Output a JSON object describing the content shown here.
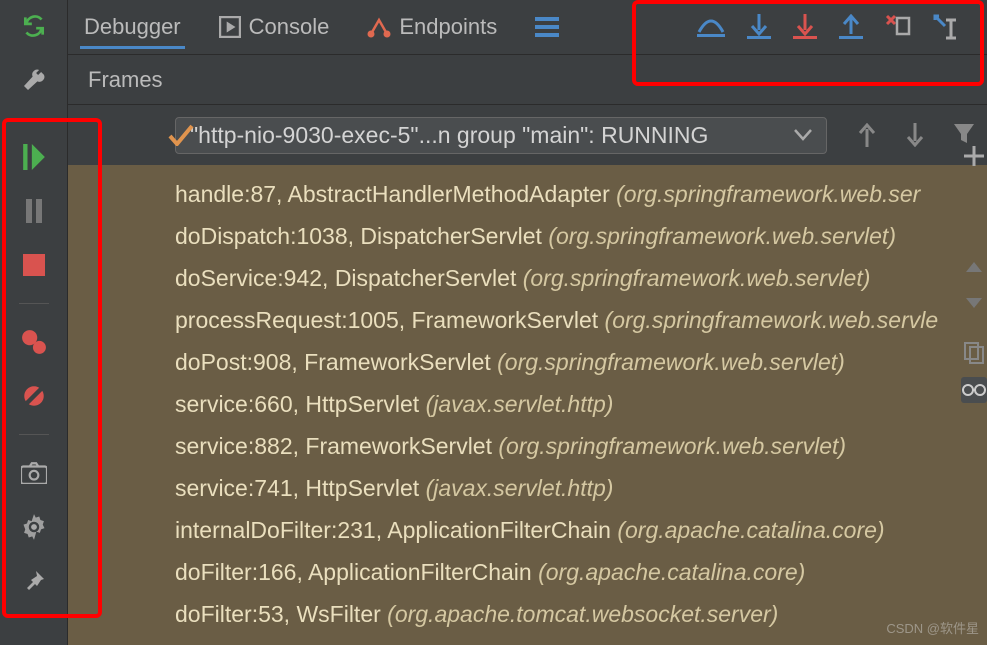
{
  "tabs": {
    "debugger": "Debugger",
    "console": "Console",
    "endpoints": "Endpoints"
  },
  "panels": {
    "frames": "Frames"
  },
  "thread_selector": {
    "text": "\"http-nio-9030-exec-5\"...n group \"main\": RUNNING"
  },
  "frames": [
    {
      "loc": "handle:87, AbstractHandlerMethodAdapter ",
      "pkg": "(org.springframework.web.ser"
    },
    {
      "loc": "doDispatch:1038, DispatcherServlet ",
      "pkg": "(org.springframework.web.servlet)"
    },
    {
      "loc": "doService:942, DispatcherServlet ",
      "pkg": "(org.springframework.web.servlet)"
    },
    {
      "loc": "processRequest:1005, FrameworkServlet ",
      "pkg": "(org.springframework.web.servle"
    },
    {
      "loc": "doPost:908, FrameworkServlet ",
      "pkg": "(org.springframework.web.servlet)"
    },
    {
      "loc": "service:660, HttpServlet ",
      "pkg": "(javax.servlet.http)"
    },
    {
      "loc": "service:882, FrameworkServlet ",
      "pkg": "(org.springframework.web.servlet)"
    },
    {
      "loc": "service:741, HttpServlet ",
      "pkg": "(javax.servlet.http)"
    },
    {
      "loc": "internalDoFilter:231, ApplicationFilterChain ",
      "pkg": "(org.apache.catalina.core)"
    },
    {
      "loc": "doFilter:166, ApplicationFilterChain ",
      "pkg": "(org.apache.catalina.core)"
    },
    {
      "loc": "doFilter:53, WsFilter ",
      "pkg": "(org.apache.tomcat.websocket.server)"
    }
  ],
  "watermark": "CSDN @软件星"
}
